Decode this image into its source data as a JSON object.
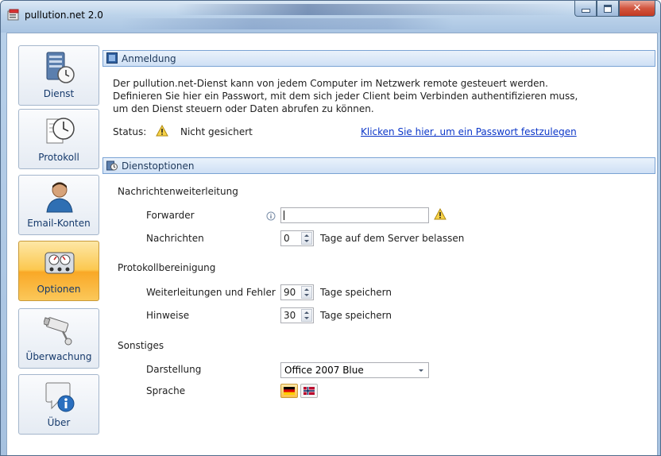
{
  "window": {
    "title": "pullution.net 2.0",
    "accent": "#1e395b"
  },
  "sidebar": {
    "items": [
      {
        "label": "Dienst",
        "icon": "server-clock-icon",
        "active": false
      },
      {
        "label": "Protokoll",
        "icon": "log-clock-icon",
        "active": false
      },
      {
        "label": "Email-Konten",
        "icon": "user-icon",
        "active": false
      },
      {
        "label": "Optionen",
        "icon": "gauges-icon",
        "active": true
      },
      {
        "label": "Überwachung",
        "icon": "camera-icon",
        "active": false
      },
      {
        "label": "Über",
        "icon": "info-icon",
        "active": false
      }
    ]
  },
  "anmeldung": {
    "title": "Anmeldung",
    "desc_line1": "Der pullution.net-Dienst kann von jedem Computer im Netzwerk remote gesteuert werden.",
    "desc_line2": "Definieren Sie hier ein Passwort, mit dem sich jeder Client beim Verbinden authentifizieren muss,",
    "desc_line3": "um den Dienst steuern oder Daten abrufen zu können.",
    "status_label": "Status:",
    "status_value": "Nicht gesichert",
    "set_password_link": "Klicken Sie hier, um ein Passwort festzulegen"
  },
  "dienstoptionen": {
    "title": "Dienstoptionen",
    "weiterleitung": {
      "heading": "Nachrichtenweiterleitung",
      "forwarder_label": "Forwarder",
      "forwarder_value": "",
      "nachrichten_label": "Nachrichten",
      "nachrichten_value": "0",
      "nachrichten_suffix": "Tage auf dem Server belassen"
    },
    "bereinigung": {
      "heading": "Protokollbereinigung",
      "fehler_label": "Weiterleitungen und Fehler",
      "fehler_value": "90",
      "fehler_suffix": "Tage speichern",
      "hinweise_label": "Hinweise",
      "hinweise_value": "30",
      "hinweise_suffix": "Tage speichern"
    },
    "sonstiges": {
      "heading": "Sonstiges",
      "darstellung_label": "Darstellung",
      "darstellung_value": "Office 2007 Blue",
      "sprache_label": "Sprache",
      "languages": [
        "german-flag-icon",
        "norwegian-flag-icon"
      ]
    }
  }
}
